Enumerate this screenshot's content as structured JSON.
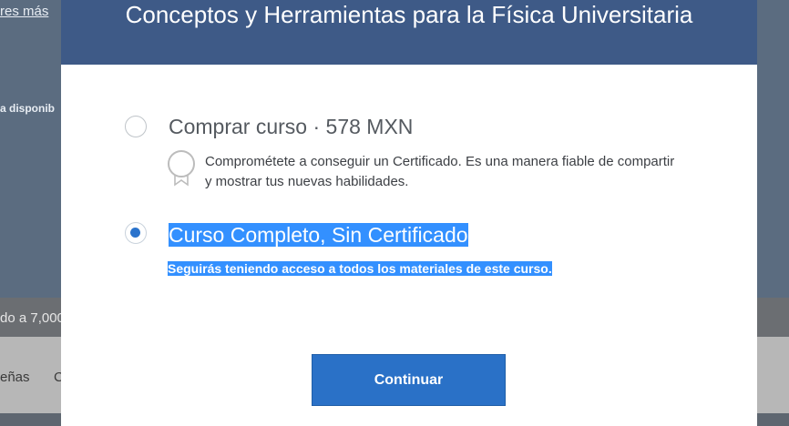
{
  "background": {
    "link_text": "res más",
    "availability_text": "a disponib",
    "enrolled_text": "do a 7,000",
    "nav_items": [
      "eñas",
      "C"
    ]
  },
  "modal": {
    "title": "Conceptos y Herramientas para la Física Universitaria",
    "options": [
      {
        "title": "Comprar curso · 578 MXN",
        "description": "Comprométete a conseguir un Certificado. Es una manera fiable de compartir y mostrar tus nuevas habilidades.",
        "selected": false,
        "icon": "certificate-ribbon-icon"
      },
      {
        "title": "Curso Completo, Sin Certificado",
        "description": "Seguirás teniendo acceso a todos los materiales de este curso.",
        "selected": true
      }
    ],
    "continue_label": "Continuar"
  },
  "colors": {
    "header": "#3e5a87",
    "primary_button": "#2a71c7",
    "radio_selected": "#2a73cc",
    "text_highlight": "#3390ff"
  }
}
